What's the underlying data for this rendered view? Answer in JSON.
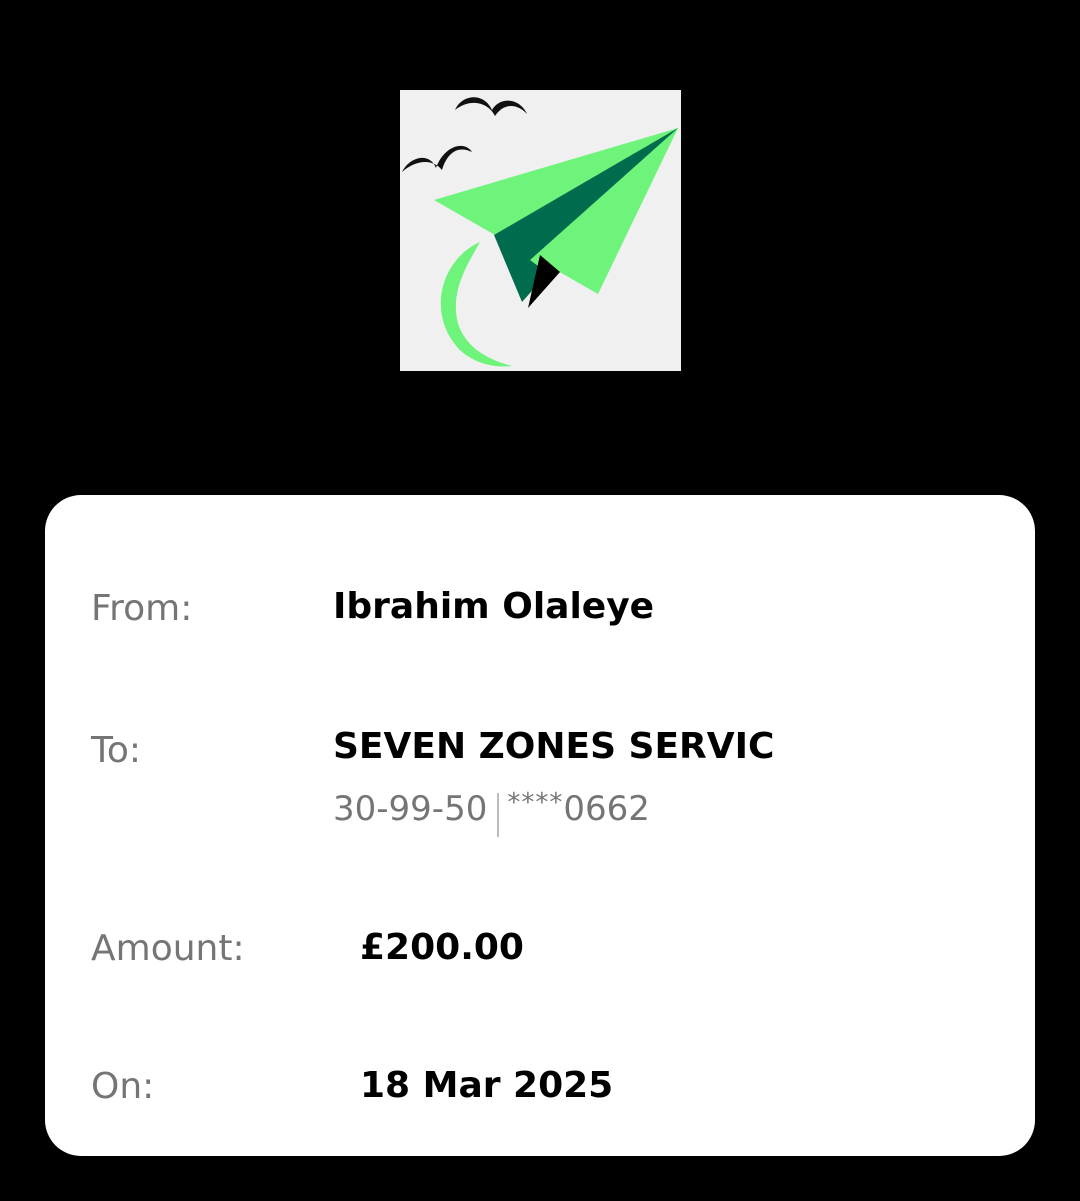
{
  "logo": {
    "name": "paper-plane-logo",
    "background": "#f0f0f0",
    "colors": {
      "light_green": "#6ef47a",
      "dark_green": "#006b4d",
      "black": "#000000"
    }
  },
  "transfer": {
    "from_label": "From:",
    "from_value": "Ibrahim Olaleye",
    "to_label": "To:",
    "to_value": "SEVEN ZONES SERVIC",
    "sort_code": "30-99-50",
    "account_mask": "****",
    "account_suffix": "0662",
    "amount_label": "Amount:",
    "amount_value": "£200.00",
    "date_label": "On:",
    "date_value": "18 Mar 2025"
  }
}
